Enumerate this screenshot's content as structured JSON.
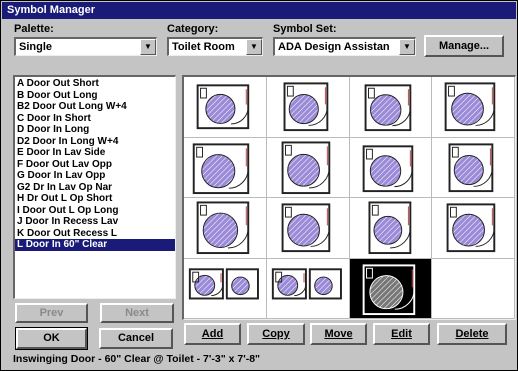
{
  "window": {
    "title": "Symbol Manager"
  },
  "palette": {
    "label": "Palette:",
    "value": "Single"
  },
  "category": {
    "label": "Category:",
    "value": "Toilet Room"
  },
  "symbol_set": {
    "label": "Symbol Set:",
    "value": "ADA Design Assistan"
  },
  "buttons": {
    "manage": "Manage...",
    "prev": "Prev",
    "next": "Next",
    "ok": "OK",
    "cancel": "Cancel",
    "add": "Add",
    "copy": "Copy",
    "move": "Move",
    "edit": "Edit",
    "delete": "Delete"
  },
  "symbol_list": [
    "A Door Out Short",
    "B Door Out Long",
    "B2 Door Out Long W+4",
    "C Door In Short",
    "D Door In Long",
    "D2 Door In Long W+4",
    "E Door In Lav Side",
    "F Door Out Lav Opp",
    "G  Door In Lav Opp",
    "G2 Dr In Lav Op Nar",
    "H Dr Out L Op Short",
    "I Door Out L Op Long",
    "J Door In Recess Lav",
    "K  Door Out Recess L",
    "L Door In 60\" Clear"
  ],
  "selected_index": 14,
  "status_text": "Inswinging Door - 60\" Clear @ Toilet - 7'-3\" x 7'-8\"",
  "colors": {
    "accent": "#1a1a78",
    "symbol_fill": "#9a8ad8",
    "wall": "#222222"
  }
}
